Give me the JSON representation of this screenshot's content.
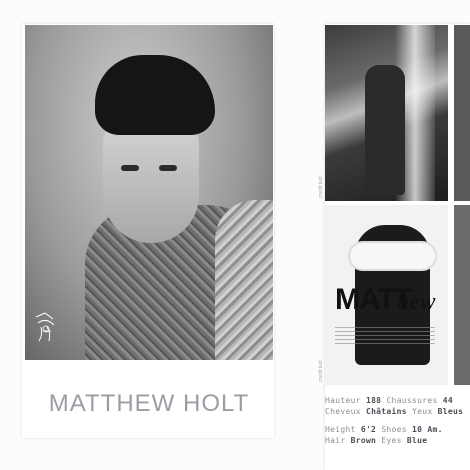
{
  "left_card": {
    "name": "MATTHEW HOLT",
    "photo_alt": "portrait-photo"
  },
  "right_card": {
    "editorial_title_bold": "MATT",
    "editorial_title_script": "hew",
    "credits_a": "credit text",
    "credits_b": "credit text"
  },
  "stats_fr": {
    "hauteur_label": "Hauteur",
    "hauteur_value": "188",
    "chaussures_label": "Chaussures",
    "chaussures_value": "44",
    "cheveux_label": "Cheveux",
    "cheveux_value": "Châtains",
    "yeux_label": "Yeux",
    "yeux_value": "Bleus"
  },
  "stats_en": {
    "height_label": "Height",
    "height_value": "6'2",
    "shoes_label": "Shoes",
    "shoes_value": "10 Am.",
    "hair_label": "Hair",
    "hair_value": "Brown",
    "eyes_label": "Eyes",
    "eyes_value": "Blue"
  },
  "colors": {
    "name_text": "#9a9ea4",
    "stats_label": "#8a8f96",
    "stats_value": "#4a4e55"
  }
}
